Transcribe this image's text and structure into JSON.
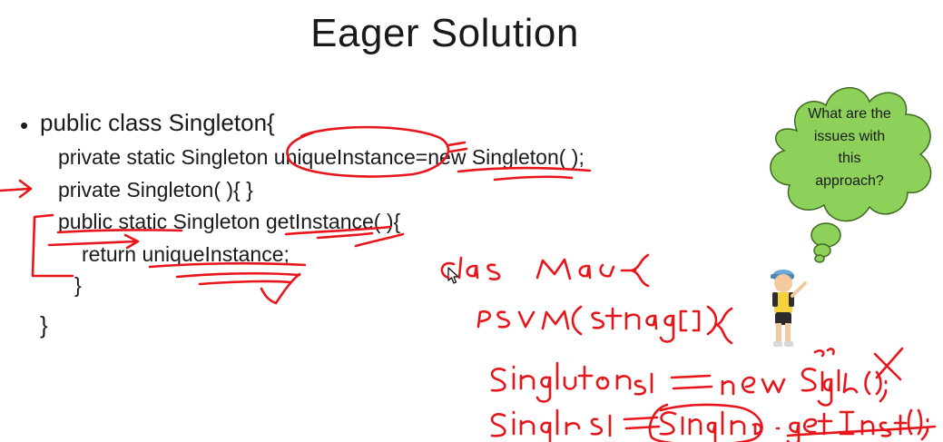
{
  "slide": {
    "title": "Eager Solution",
    "code_lines": [
      "public class Singleton{",
      "private static Singleton uniqueInstance=new Singleton( );",
      "private Singleton( ){ }",
      "public static Singleton getInstance( ){",
      "return uniqueInstance;",
      "}",
      "}"
    ],
    "bullet": "•",
    "thought_bubble": {
      "lines": [
        "What are the",
        "issues with",
        "this",
        "approach?"
      ],
      "fill_color": "#8ed15a",
      "border_color": "#3e6a1f"
    },
    "annotation_color": "#e8151b",
    "handwritten_notes": [
      "class Main {",
      "PSVM(String args[]) {",
      "Singleton s1 = new Singleton();",
      "Singleton s1 = Singleton.getInstance();"
    ],
    "icons": [
      "pointer-cursor-icon",
      "cartoon-person-icon",
      "thought-cloud-icon"
    ]
  }
}
